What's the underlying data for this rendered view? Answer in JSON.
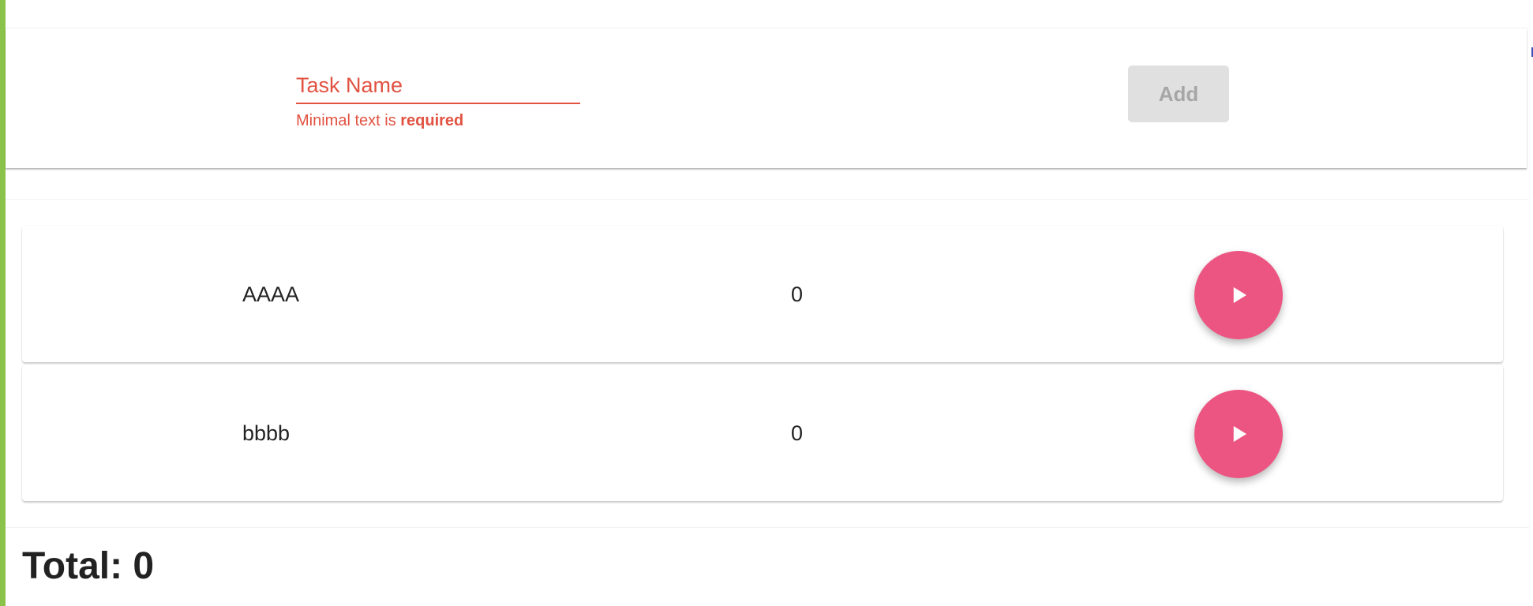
{
  "form": {
    "placeholder": "Task Name",
    "value": "",
    "error_prefix": "Minimal text is ",
    "error_emphasis": "required",
    "add_label": "Add"
  },
  "tasks": [
    {
      "name": "AAAA",
      "count": "0"
    },
    {
      "name": "bbbb",
      "count": "0"
    }
  ],
  "icons": {
    "play": "play-icon"
  },
  "total": {
    "label": "Total: ",
    "value": "0"
  },
  "colors": {
    "accent_left": "#8bc34a",
    "error": "#e15241",
    "play_button": "#ec5582",
    "button_disabled_bg": "#e0e0e0",
    "button_disabled_text": "#a6a6a6"
  }
}
